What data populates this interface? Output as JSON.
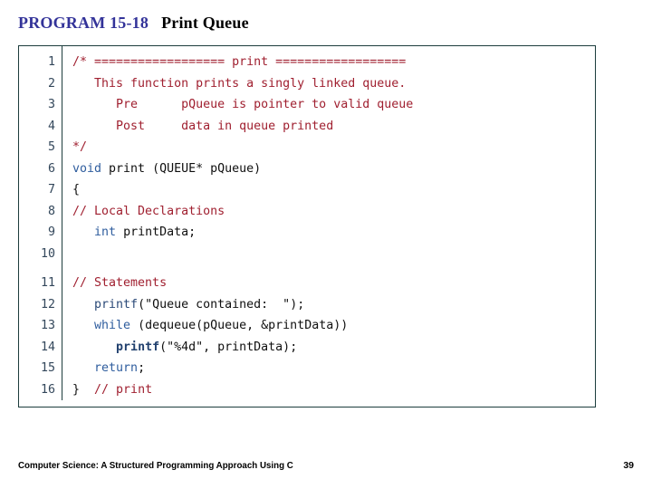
{
  "title": {
    "program_label": "PROGRAM 15-18",
    "program_name": "Print Queue"
  },
  "code": {
    "lines": [
      {
        "number": "1",
        "tokens": [
          {
            "text": "/* ================== ",
            "style": "comment"
          },
          {
            "text": "print",
            "style": "comment"
          },
          {
            "text": " ==================",
            "style": "comment"
          }
        ]
      },
      {
        "number": "2",
        "tokens": [
          {
            "text": "   This function prints a singly linked queue.",
            "style": "comment"
          }
        ]
      },
      {
        "number": "3",
        "tokens": [
          {
            "text": "      Pre      pQueue is pointer to valid queue",
            "style": "comment"
          }
        ]
      },
      {
        "number": "4",
        "tokens": [
          {
            "text": "      Post     data in queue printed",
            "style": "comment"
          }
        ]
      },
      {
        "number": "5",
        "tokens": [
          {
            "text": "*/",
            "style": "comment"
          }
        ]
      },
      {
        "number": "6",
        "tokens": [
          {
            "text": "void",
            "style": "keyword"
          },
          {
            "text": " print (QUEUE* pQueue)",
            "style": "plain"
          }
        ]
      },
      {
        "number": "7",
        "tokens": [
          {
            "text": "{",
            "style": "plain"
          }
        ]
      },
      {
        "number": "8",
        "tokens": [
          {
            "text": "// Local Declarations",
            "style": "comment"
          }
        ]
      },
      {
        "number": "9",
        "tokens": [
          {
            "text": "   ",
            "style": "plain"
          },
          {
            "text": "int",
            "style": "keyword"
          },
          {
            "text": " printData;",
            "style": "plain"
          }
        ]
      },
      {
        "number": "10",
        "tokens": []
      },
      {
        "number": "11",
        "spacer": true,
        "tokens": [
          {
            "text": "// Statements",
            "style": "comment"
          }
        ]
      },
      {
        "number": "12",
        "tokens": [
          {
            "text": "   ",
            "style": "plain"
          },
          {
            "text": "printf",
            "style": "fn"
          },
          {
            "text": "(\"Queue contained:  \");",
            "style": "plain"
          }
        ]
      },
      {
        "number": "13",
        "tokens": [
          {
            "text": "   ",
            "style": "plain"
          },
          {
            "text": "while",
            "style": "keyword"
          },
          {
            "text": " (dequeue(pQueue, &printData))",
            "style": "plain"
          }
        ]
      },
      {
        "number": "14",
        "tokens": [
          {
            "text": "      ",
            "style": "plain"
          },
          {
            "text": "printf",
            "style": "fn-bold"
          },
          {
            "text": "(\"%4d\", printData);",
            "style": "plain"
          }
        ]
      },
      {
        "number": "15",
        "tokens": [
          {
            "text": "   ",
            "style": "plain"
          },
          {
            "text": "return",
            "style": "keyword"
          },
          {
            "text": ";",
            "style": "plain"
          }
        ]
      },
      {
        "number": "16",
        "tokens": [
          {
            "text": "}  ",
            "style": "plain"
          },
          {
            "text": "// print",
            "style": "comment"
          }
        ]
      }
    ]
  },
  "footer": {
    "book_title": "Computer Science: A Structured Programming Approach Using C",
    "page_number": "39"
  },
  "colors": {
    "title_accent": "#333399",
    "comment": "#a02030",
    "keyword": "#2f5d9e",
    "border": "#1d3d3d",
    "code_plain": "#101010"
  }
}
